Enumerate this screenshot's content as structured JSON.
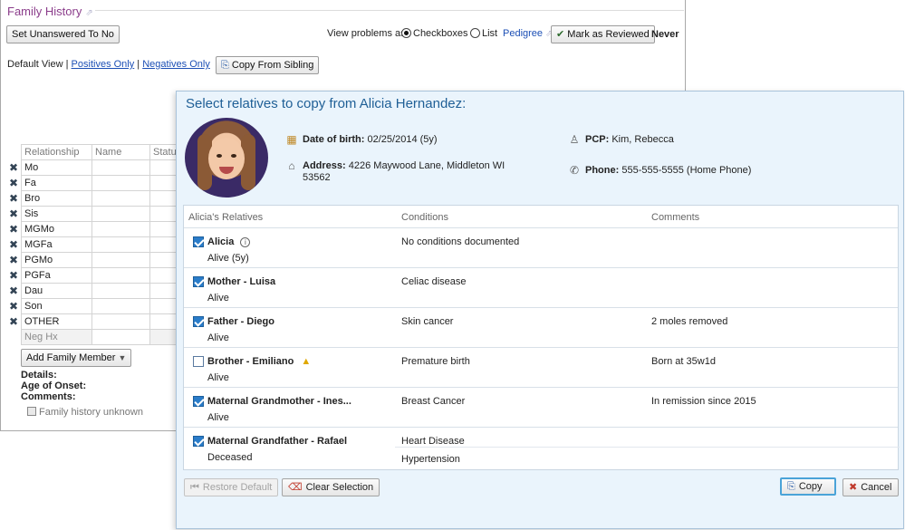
{
  "background": {
    "title": "Family History",
    "set_unanswered_label": "Set Unanswered To No",
    "view_problems_label": "View problems as:",
    "view_options": [
      "Checkboxes",
      "List"
    ],
    "pedigree_link": "Pedigree",
    "mark_reviewed_label": "Mark as Reviewed",
    "review_status": "Never",
    "default_view_label": "Default View",
    "positives_only": "Positives Only",
    "negatives_only": "Negatives Only",
    "copy_from_sibling": "Copy From Sibling",
    "table_headers": [
      "Relationship",
      "Name",
      "Status"
    ],
    "relationships": [
      "Mo",
      "Fa",
      "Bro",
      "Sis",
      "MGMo",
      "MGFa",
      "PGMo",
      "PGFa",
      "Dau",
      "Son",
      "OTHER"
    ],
    "neg_hx": "Neg Hx",
    "add_family_member": "Add Family Member",
    "details_label": "Details:",
    "age_of_onset_label": "Age of Onset:",
    "comments_label": "Comments:",
    "family_history_unknown": "Family history unknown"
  },
  "dialog": {
    "title": "Select relatives to copy from Alicia Hernandez:",
    "patient": {
      "dob_label": "Date of birth:",
      "dob_value": "02/25/2014 (5y)",
      "address_label": "Address:",
      "address_line1": "4226 Maywood Lane, Middleton WI",
      "address_line2": "53562",
      "pcp_label": "PCP:",
      "pcp_value": "Kim, Rebecca",
      "phone_label": "Phone:",
      "phone_value": "555-555-5555 (Home Phone)"
    },
    "columns": [
      "Alicia's Relatives",
      "Conditions",
      "Comments"
    ],
    "relatives": [
      {
        "name": "Alicia",
        "status": "Alive (5y)",
        "checked": true,
        "condition": "No conditions documented",
        "comment": "",
        "icon": "info-icon"
      },
      {
        "name": "Mother - Luisa",
        "status": "Alive",
        "checked": true,
        "condition": "Celiac disease",
        "comment": ""
      },
      {
        "name": "Father - Diego",
        "status": "Alive",
        "checked": true,
        "condition": "Skin cancer",
        "comment": "2 moles removed"
      },
      {
        "name": "Brother - Emiliano",
        "status": "Alive",
        "checked": false,
        "condition": "Premature birth",
        "comment": "Born at 35w1d",
        "icon": "warning-icon"
      },
      {
        "name": "Maternal Grandmother - Ines...",
        "status": "Alive",
        "checked": true,
        "condition": "Breast Cancer",
        "comment": "In remission since 2015"
      },
      {
        "name": "Maternal Grandfather - Rafael",
        "status": "Deceased",
        "checked": true,
        "condition": "Heart Disease",
        "condition2": "Hypertension",
        "comment": ""
      }
    ],
    "restore_default": "Restore Default",
    "clear_selection": "Clear Selection",
    "copy": "Copy",
    "cancel": "Cancel"
  }
}
